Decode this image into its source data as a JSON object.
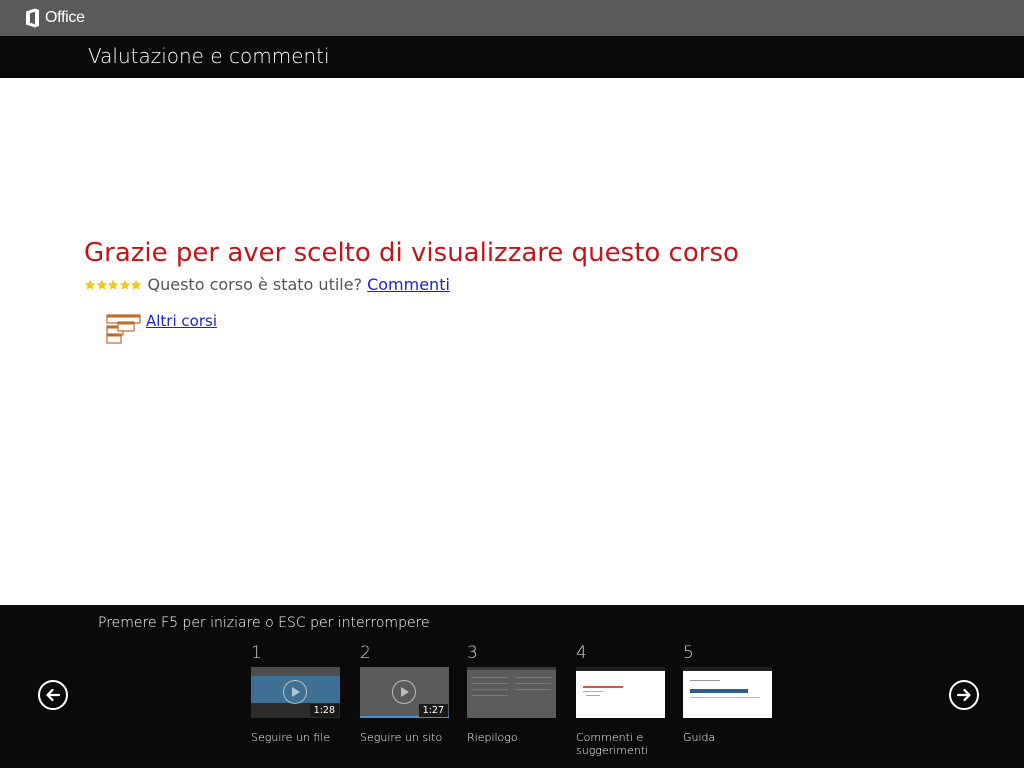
{
  "app": {
    "brand": "Office"
  },
  "header": {
    "title": "Valutazione e commenti"
  },
  "main": {
    "heading": "Grazie per aver scelto di visualizzare questo corso",
    "rating": {
      "stars": 5,
      "question": "Questo corso è stato utile?",
      "feedback_link": "Commenti"
    },
    "more_courses": "Altri corsi"
  },
  "footer": {
    "instructions": "Premere F5 per iniziare o ESC per interrompere",
    "slides": [
      {
        "number": "1",
        "label": "Seguire un file",
        "duration": "1:28"
      },
      {
        "number": "2",
        "label": "Seguire un sito",
        "duration": "1:27"
      },
      {
        "number": "3",
        "label": "Riepilogo"
      },
      {
        "number": "4",
        "label": "Commenti e suggerimenti"
      },
      {
        "number": "5",
        "label": "Guida"
      }
    ]
  },
  "colors": {
    "accent_red": "#c1151b",
    "link_blue": "#1e1ed6",
    "star_yellow": "#f5c518",
    "topbar_gray": "#5a5a5a",
    "bar_black": "#0a0a0a"
  }
}
